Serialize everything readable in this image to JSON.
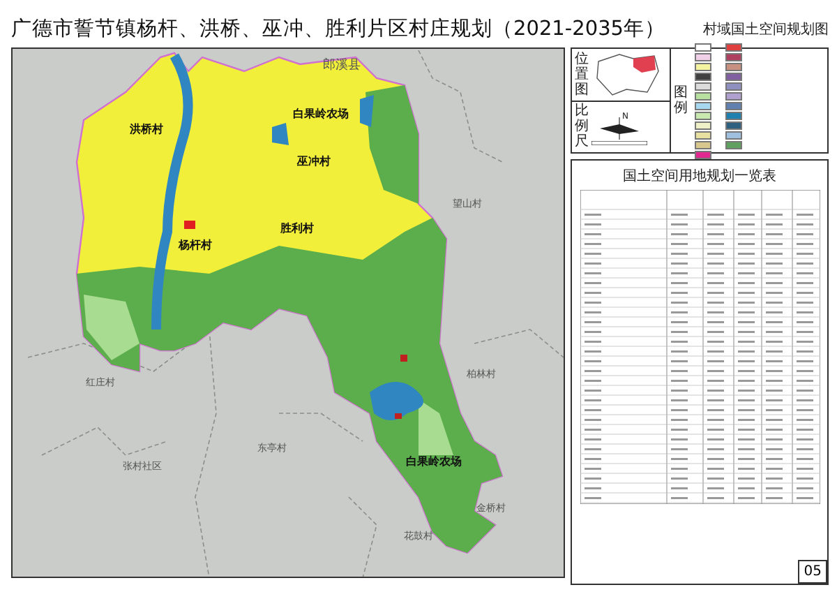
{
  "title": "广德市誓节镇杨杆、洪桥、巫冲、胜利片区村庄规划（2021-2035年）",
  "subtitle": "村域国土空间规划图",
  "map": {
    "labels": [
      {
        "text": "郎溪县",
        "kind": "county"
      },
      {
        "text": "白果岭农场",
        "kind": "inside"
      },
      {
        "text": "洪桥村",
        "kind": "inside"
      },
      {
        "text": "巫冲村",
        "kind": "inside"
      },
      {
        "text": "杨杆村",
        "kind": "inside"
      },
      {
        "text": "胜利村",
        "kind": "inside"
      },
      {
        "text": "望山村",
        "kind": "outside"
      },
      {
        "text": "红庄村",
        "kind": "outside"
      },
      {
        "text": "柏林村",
        "kind": "outside"
      },
      {
        "text": "张村社区",
        "kind": "outside"
      },
      {
        "text": "东亭村",
        "kind": "outside"
      },
      {
        "text": "白果岭农场",
        "kind": "inside"
      },
      {
        "text": "金桥村",
        "kind": "outside"
      },
      {
        "text": "花鼓村",
        "kind": "outside"
      }
    ]
  },
  "location_map": {
    "label": "位置图"
  },
  "scale": {
    "label": "比例尺",
    "north": "N"
  },
  "legend": {
    "label": "图例",
    "items": [
      {
        "color": "#ffffff"
      },
      {
        "color": "#f0d0e8"
      },
      {
        "color": "#f4f4a0"
      },
      {
        "color": "#404040"
      },
      {
        "color": "#dcdcdc"
      },
      {
        "color": "#b8e0a0"
      },
      {
        "color": "#a8d8f0"
      },
      {
        "color": "#c8e8b0"
      },
      {
        "color": "#f0f0c8"
      },
      {
        "color": "#e8e0a0"
      },
      {
        "color": "#d8c890"
      },
      {
        "color": "#e02890"
      },
      {
        "color": "#e04040"
      },
      {
        "color": "#b04060"
      },
      {
        "color": "#c89080"
      },
      {
        "color": "#8060a0"
      },
      {
        "color": "#9090c0"
      },
      {
        "color": "#b0a0d0"
      },
      {
        "color": "#6080b0"
      },
      {
        "color": "#2080b0"
      },
      {
        "color": "#306080"
      },
      {
        "color": "#a0c0e0"
      },
      {
        "color": "#60a060"
      }
    ]
  },
  "table": {
    "title": "国土空间用地规划一览表"
  },
  "page_number": "05"
}
